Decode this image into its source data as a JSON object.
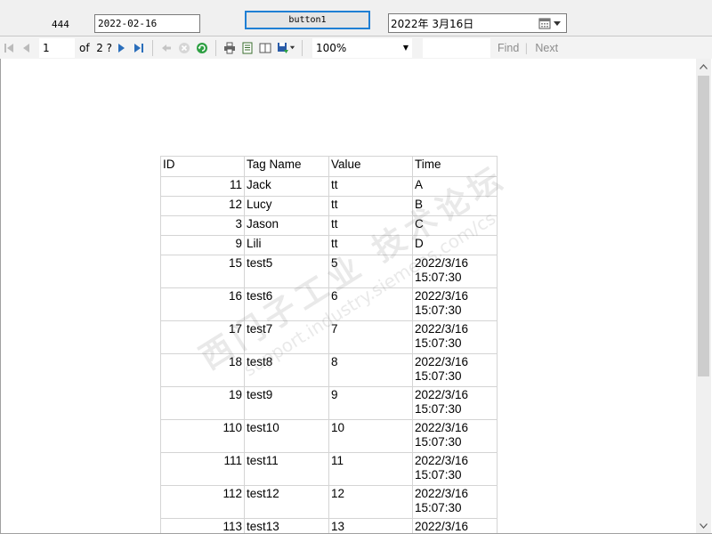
{
  "form": {
    "label_text": "444",
    "date_text_value": "2022-02-16",
    "button_label": "button1",
    "datepicker_value": "2022年  3月16日"
  },
  "toolbar": {
    "page_current": "1",
    "page_of_label": "of  2 ?",
    "zoom_value": "100%",
    "find_input_value": "",
    "find_label": "Find",
    "next_label": "Next",
    "find_separator": "|"
  },
  "report": {
    "headers": [
      "ID",
      "Tag Name",
      "Value",
      "Time"
    ],
    "rows": [
      {
        "id": "11",
        "tag": "Jack",
        "value": "tt",
        "time": "A"
      },
      {
        "id": "12",
        "tag": "Lucy",
        "value": "tt",
        "time": "B"
      },
      {
        "id": "3",
        "tag": "Jason",
        "value": "tt",
        "time": "C"
      },
      {
        "id": "9",
        "tag": "Lili",
        "value": "tt",
        "time": "D"
      },
      {
        "id": "15",
        "tag": "test5",
        "value": "5",
        "time": "2022/3/16 15:07:30"
      },
      {
        "id": "16",
        "tag": "test6",
        "value": "6",
        "time": "2022/3/16 15:07:30"
      },
      {
        "id": "17",
        "tag": "test7",
        "value": "7",
        "time": "2022/3/16 15:07:30"
      },
      {
        "id": "18",
        "tag": "test8",
        "value": "8",
        "time": "2022/3/16 15:07:30"
      },
      {
        "id": "19",
        "tag": "test9",
        "value": "9",
        "time": "2022/3/16 15:07:30"
      },
      {
        "id": "110",
        "tag": "test10",
        "value": "10",
        "time": "2022/3/16 15:07:30"
      },
      {
        "id": "111",
        "tag": "test11",
        "value": "11",
        "time": "2022/3/16 15:07:30"
      },
      {
        "id": "112",
        "tag": "test12",
        "value": "12",
        "time": "2022/3/16 15:07:30"
      },
      {
        "id": "113",
        "tag": "test13",
        "value": "13",
        "time": "2022/3/16"
      }
    ]
  },
  "watermark": {
    "line1": "西门子工业 技术论坛",
    "line2": "support.industry.siemens.com/cs"
  },
  "colors": {
    "button_border": "#1f7fd4",
    "nav_arrow": "#2a6ebb",
    "refresh_green": "#2ea043",
    "grid_line": "#d4d4d4"
  }
}
